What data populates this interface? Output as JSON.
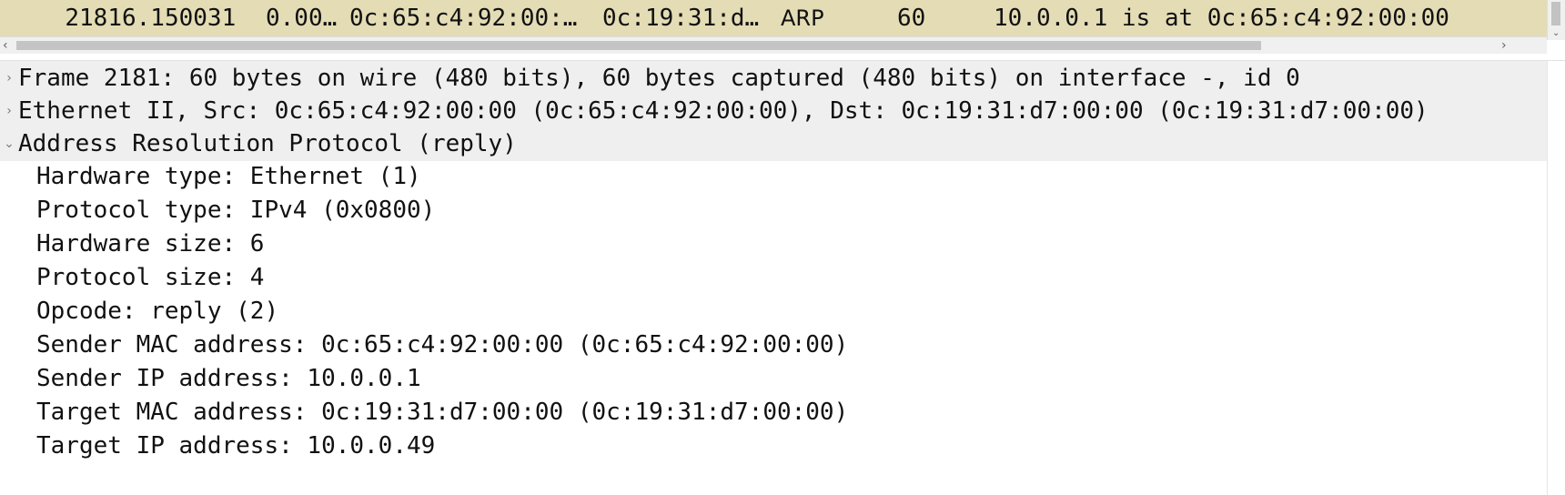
{
  "packet_list": {
    "selected_row": {
      "no": "2181",
      "time": "6.150031",
      "source": "0.00…",
      "destination": "0c:65:c4:92:00:…",
      "destination2": "0c:19:31:d…",
      "protocol": "ARP",
      "length": "60",
      "info": "10.0.0.1 is at 0c:65:c4:92:00:00"
    },
    "row_color": "#e4dcb5"
  },
  "scrollbars": {
    "left_arrow": "‹",
    "right_arrow": "›",
    "down_arrow": "⌄"
  },
  "details": {
    "frame": {
      "toggle": "›",
      "label": "Frame 2181: 60 bytes on wire (480 bits), 60 bytes captured (480 bits) on interface -, id 0"
    },
    "ethernet": {
      "toggle": "›",
      "label": "Ethernet II, Src: 0c:65:c4:92:00:00 (0c:65:c4:92:00:00), Dst: 0c:19:31:d7:00:00 (0c:19:31:d7:00:00)"
    },
    "arp": {
      "toggle": "⌄",
      "label": "Address Resolution Protocol (reply)",
      "fields": [
        "Hardware type: Ethernet (1)",
        "Protocol type: IPv4 (0x0800)",
        "Hardware size: 6",
        "Protocol size: 4",
        "Opcode: reply (2)",
        "Sender MAC address: 0c:65:c4:92:00:00 (0c:65:c4:92:00:00)",
        "Sender IP address: 10.0.0.1",
        "Target MAC address: 0c:19:31:d7:00:00 (0c:19:31:d7:00:00)",
        "Target IP address: 10.0.0.49"
      ]
    }
  }
}
